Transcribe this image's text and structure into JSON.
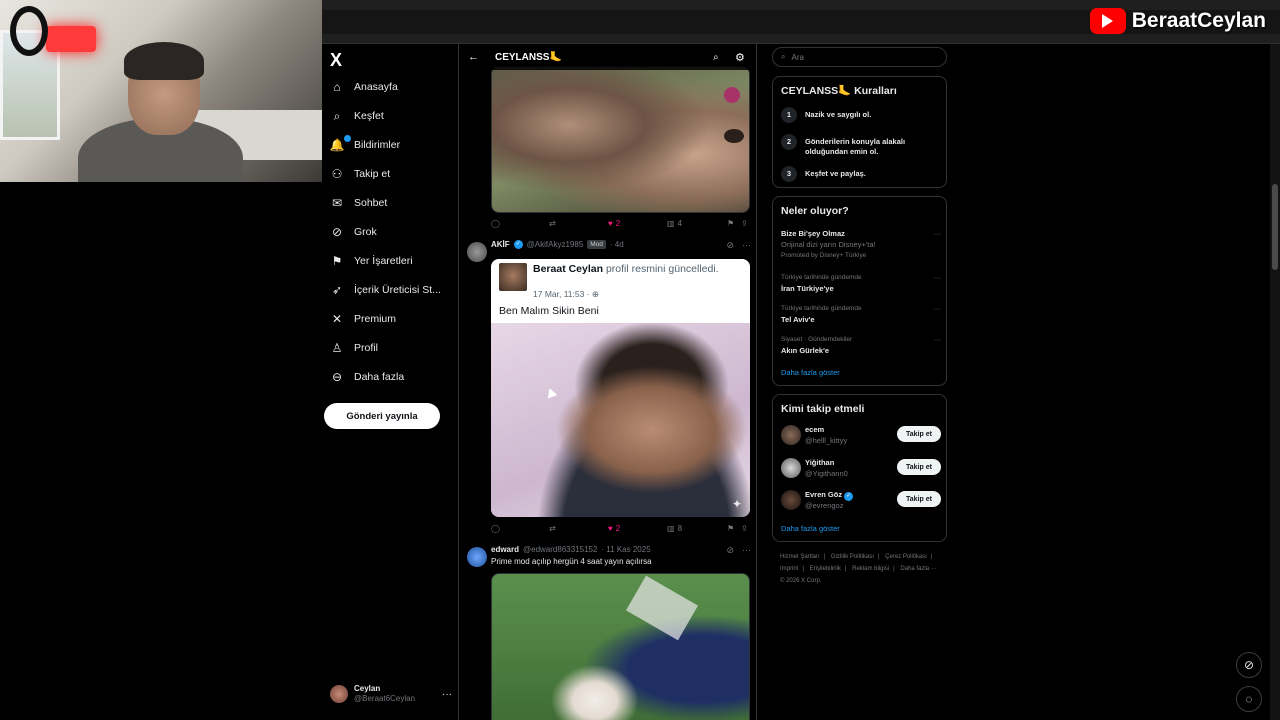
{
  "overlay": {
    "channel_name": "BeraatCeylan"
  },
  "nav": {
    "logo": "X",
    "items": [
      {
        "label": "Anasayfa",
        "icon": "home-icon",
        "glyph": "⌂"
      },
      {
        "label": "Keşfet",
        "icon": "search-icon",
        "glyph": "⌕"
      },
      {
        "label": "Bildirimler",
        "icon": "bell-icon",
        "glyph": "🔔"
      },
      {
        "label": "Takip et",
        "icon": "add-person-icon",
        "glyph": "⚇"
      },
      {
        "label": "Sohbet",
        "icon": "mail-icon",
        "glyph": "✉"
      },
      {
        "label": "Grok",
        "icon": "grok-icon",
        "glyph": "⊘"
      },
      {
        "label": "Yer İşaretleri",
        "icon": "bookmark-icon",
        "glyph": "⚑"
      },
      {
        "label": "İçerik Üreticisi St...",
        "icon": "rocket-icon",
        "glyph": "➶"
      },
      {
        "label": "Premium",
        "icon": "x-premium-icon",
        "glyph": "✕"
      },
      {
        "label": "Profil",
        "icon": "person-icon",
        "glyph": "♙"
      },
      {
        "label": "Daha fazla",
        "icon": "more-circle-icon",
        "glyph": "⊖"
      }
    ],
    "post_button": "Gönderi yayınla",
    "account": {
      "name": "Ceylan",
      "handle": "@Beraat6Ceylan",
      "more": "···"
    }
  },
  "feed": {
    "title": "CEYLANSS🦶",
    "posts": [
      {
        "actions": {
          "reply": "",
          "repost": "",
          "likes": "2",
          "views": "4"
        }
      },
      {
        "author": "AKİF",
        "handle": "@AkifAkyz1985",
        "badge": "Mod",
        "time": "· 4d",
        "quote": {
          "name": "Beraat Ceylan",
          "action_text": "profil resmini güncelledi.",
          "time": "17 Mar, 11:53 · ",
          "text": "Ben Malım Sikin Beni"
        },
        "actions": {
          "likes": "2",
          "views": "8"
        }
      },
      {
        "author": "edward",
        "handle": "@edward863315152",
        "time": "· 11 Kas 2025",
        "text": "Prime mod açılıp hergün 4 saat yayın açılırsa"
      }
    ]
  },
  "right": {
    "search_placeholder": "Ara",
    "rules": {
      "title": "CEYLANSS🦶 Kuralları",
      "items": [
        {
          "num": "1",
          "text": "Nazik ve saygılı ol."
        },
        {
          "num": "2",
          "text": "Gönderilerin konuyla alakalı olduğundan emin ol."
        },
        {
          "num": "3",
          "text": "Keşfet ve paylaş."
        }
      ]
    },
    "trends": {
      "title": "Neler oluyor?",
      "items": [
        {
          "title": "Bize Bi'şey Olmaz",
          "sub": "Orijinal dizi yarın Disney+'ta!",
          "promo": "Promoted by Disney+ Türkiye"
        },
        {
          "context": "Türkiye tarihinde gündemde",
          "title": "İran Türkiye'ye"
        },
        {
          "context": "Türkiye tarihinde gündemde",
          "title": "Tel Aviv'e"
        },
        {
          "context": "Siyaset · Gündemdekiler",
          "title": "Akın Gürlek'e"
        }
      ],
      "show_more": "Daha fazla göster"
    },
    "who_to_follow": {
      "title": "Kimi takip etmeli",
      "items": [
        {
          "name": "ecem",
          "handle": "@helll_kittyy",
          "button": "Takip et"
        },
        {
          "name": "Yiğithan",
          "handle": "@Yigithann0",
          "button": "Takip et"
        },
        {
          "name": "Evren Göz",
          "handle": "@evrengoz",
          "button": "Takip et"
        }
      ],
      "show_more": "Daha fazla göster"
    },
    "footer": [
      "Hizmet Şartları",
      "|",
      "Gizlilik Politikası",
      "|",
      "Çerez Politikası",
      "|",
      "Imprint",
      "|",
      "Erişilebilirlik",
      "|",
      "Reklam bilgisi",
      "|",
      "Daha fazla ···",
      "© 2026 X Corp."
    ]
  },
  "colors": {
    "accent": "#1d9bf0",
    "like": "#f91880",
    "background": "#000000",
    "youtube": "#ff0000"
  }
}
